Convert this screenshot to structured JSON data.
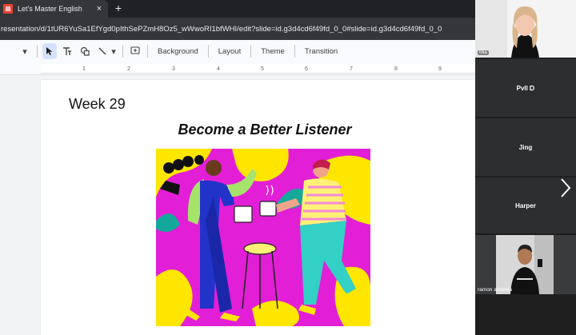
{
  "browser": {
    "tab_title": "Let's Master English",
    "tab_close": "×",
    "new_tab": "+",
    "url": "resentation/d/1tUR6YuSa1EfYgd0pIthSePZmH8Oz5_wWwoRI1bfWHI/edit?slide=id.g3d4cd6f49fd_0_0#slide=id.g3d4cd6f49fd_0_0"
  },
  "toolbar": {
    "background_label": "Background",
    "layout_label": "Layout",
    "theme_label": "Theme",
    "transition_label": "Transition"
  },
  "ruler": {
    "ticks": [
      "1",
      "2",
      "3",
      "4",
      "5",
      "6",
      "7",
      "8",
      "9"
    ]
  },
  "slide": {
    "week_label": "Week 29",
    "heading": "Become a Better Listener"
  },
  "meet": {
    "self_label": "Mia",
    "participants": [
      "Pvll Ɒ",
      "Jing",
      "Harper"
    ],
    "video_participant": "ramon almeida"
  },
  "colors": {
    "illus_bg": "#e21fd6",
    "illus_yellow": "#ffe600",
    "browser_bg": "#202124",
    "panel_tile": "#2d2e30"
  }
}
